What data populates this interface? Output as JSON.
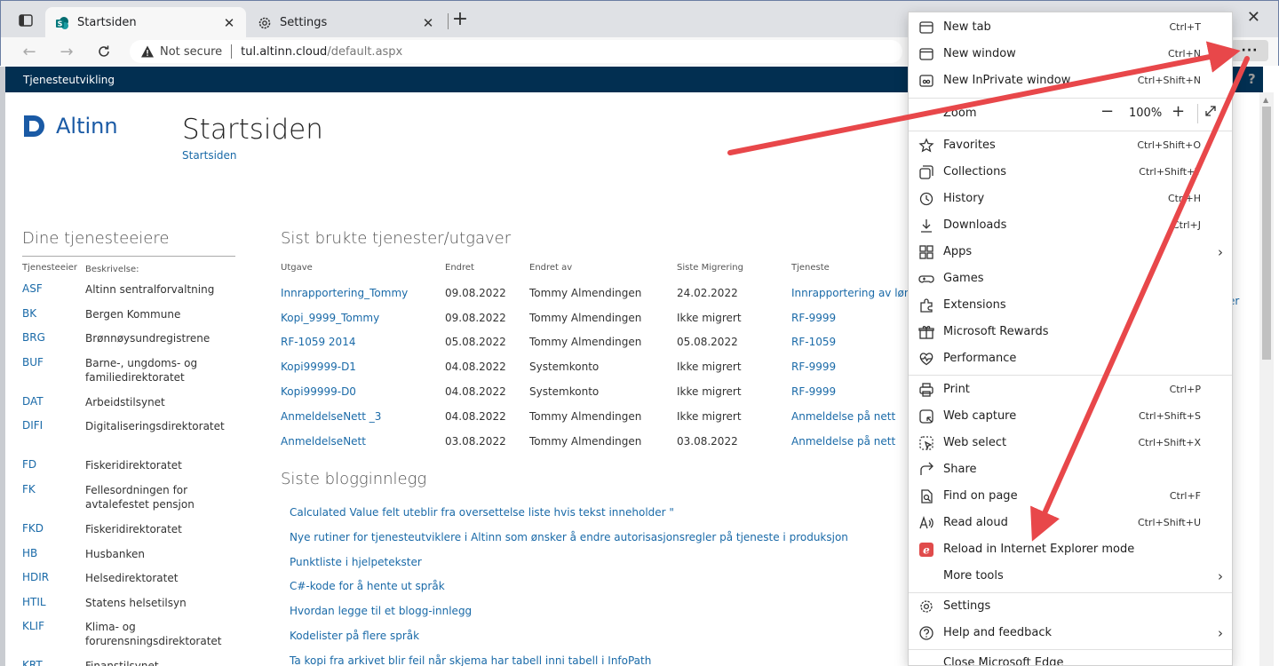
{
  "browser": {
    "tabs": [
      {
        "title": "Startsiden",
        "active": true
      },
      {
        "title": "Settings",
        "active": false
      }
    ],
    "address": {
      "security": "Not secure",
      "host": "tul.altinn.cloud",
      "path": "/default.aspx"
    }
  },
  "site": {
    "topbar": "Tjenesteutvikling",
    "help": "?",
    "logo_text": "Altinn",
    "page_title": "Startsiden",
    "breadcrumb": "Startsiden",
    "edge_fragment": "er"
  },
  "owners": {
    "title": "Dine tjenesteeiere",
    "headers": [
      "Tjenesteeier",
      "Beskrivelse:"
    ],
    "rows": [
      {
        "code": "ASF",
        "desc": "Altinn sentralforvaltning"
      },
      {
        "code": "BK",
        "desc": "Bergen Kommune"
      },
      {
        "code": "BRG",
        "desc": "Brønnøysundregistrene"
      },
      {
        "code": "BUF",
        "desc": "Barne-, ungdoms- og familiedirektoratet"
      },
      {
        "code": "DAT",
        "desc": "Arbeidstilsynet"
      },
      {
        "code": "DIFI",
        "desc": "Digitaliseringsdirektoratet"
      },
      {
        "code": "FD",
        "desc": "Fiskeridirektoratet"
      },
      {
        "code": "FK",
        "desc": "Fellesordningen for avtalefestet pensjon"
      },
      {
        "code": "FKD",
        "desc": "Fiskeridirektoratet"
      },
      {
        "code": "HB",
        "desc": "Husbanken"
      },
      {
        "code": "HDIR",
        "desc": "Helsedirektoratet"
      },
      {
        "code": "HTIL",
        "desc": "Statens helsetilsyn"
      },
      {
        "code": "KLIF",
        "desc": "Klima- og forurensningsdirektoratet"
      },
      {
        "code": "KRT",
        "desc": "Finanstilsynet"
      }
    ]
  },
  "recent": {
    "title": "Sist brukte tjenester/utgaver",
    "headers": [
      "Utgave",
      "Endret",
      "Endret av",
      "Siste Migrering",
      "Tjeneste"
    ],
    "rows": [
      [
        "Innrapportering_Tommy",
        "09.08.2022",
        "Tommy Almendingen",
        "24.02.2022",
        "Innrapportering av lønn"
      ],
      [
        "Kopi_9999_Tommy",
        "09.08.2022",
        "Tommy Almendingen",
        "Ikke migrert",
        "RF-9999"
      ],
      [
        "RF-1059 2014",
        "05.08.2022",
        "Tommy Almendingen",
        "05.08.2022",
        "RF-1059"
      ],
      [
        "Kopi99999-D1",
        "04.08.2022",
        "Systemkonto",
        "Ikke migrert",
        "RF-9999"
      ],
      [
        "Kopi99999-D0",
        "04.08.2022",
        "Systemkonto",
        "Ikke migrert",
        "RF-9999"
      ],
      [
        "AnmeldelseNett _3",
        "04.08.2022",
        "Tommy Almendingen",
        "Ikke migrert",
        "Anmeldelse på nett"
      ],
      [
        "AnmeldelseNett",
        "03.08.2022",
        "Tommy Almendingen",
        "03.08.2022",
        "Anmeldelse på nett"
      ]
    ]
  },
  "blog": {
    "title": "Siste blogginnlegg",
    "items": [
      "Calculated Value felt uteblir fra oversettelse liste hvis tekst inneholder \"",
      "Nye rutiner for tjenesteutviklere i Altinn som ønsker å endre autorisasjonsregler på tjeneste i produksjon",
      "Punktliste i hjelpetekster",
      "C#-kode for å hente ut språk",
      "Hvordan legge til et blogg-innlegg",
      "Kodelister på flere språk",
      "Ta kopi fra arkivet blir feil når skjema har tabell inni tabell i InfoPath"
    ]
  },
  "menu": {
    "items": [
      {
        "label": "New tab",
        "shortcut": "Ctrl+T",
        "icon": "new-tab-icon"
      },
      {
        "label": "New window",
        "shortcut": "Ctrl+N",
        "icon": "new-window-icon"
      },
      {
        "label": "New InPrivate window",
        "shortcut": "Ctrl+Shift+N",
        "icon": "inprivate-icon"
      },
      {
        "label": "Zoom",
        "value": "100%"
      },
      {
        "label": "Favorites",
        "shortcut": "Ctrl+Shift+O",
        "icon": "favorites-icon"
      },
      {
        "label": "Collections",
        "shortcut": "Ctrl+Shift+Y",
        "icon": "collections-icon"
      },
      {
        "label": "History",
        "shortcut": "Ctrl+H",
        "icon": "history-icon"
      },
      {
        "label": "Downloads",
        "shortcut": "Ctrl+J",
        "icon": "downloads-icon"
      },
      {
        "label": "Apps",
        "icon": "apps-icon"
      },
      {
        "label": "Games",
        "icon": "games-icon"
      },
      {
        "label": "Extensions",
        "icon": "extensions-icon"
      },
      {
        "label": "Microsoft Rewards",
        "icon": "rewards-icon"
      },
      {
        "label": "Performance",
        "icon": "performance-icon"
      },
      {
        "label": "Print",
        "shortcut": "Ctrl+P",
        "icon": "print-icon"
      },
      {
        "label": "Web capture",
        "shortcut": "Ctrl+Shift+S",
        "icon": "web-capture-icon"
      },
      {
        "label": "Web select",
        "shortcut": "Ctrl+Shift+X",
        "icon": "web-select-icon"
      },
      {
        "label": "Share",
        "icon": "share-icon"
      },
      {
        "label": "Find on page",
        "shortcut": "Ctrl+F",
        "icon": "find-icon"
      },
      {
        "label": "Read aloud",
        "shortcut": "Ctrl+Shift+U",
        "icon": "read-aloud-icon"
      },
      {
        "label": "Reload in Internet Explorer mode",
        "icon": "ie-mode-icon"
      },
      {
        "label": "More tools"
      },
      {
        "label": "Settings",
        "icon": "settings-icon"
      },
      {
        "label": "Help and feedback",
        "icon": "help-icon"
      },
      {
        "label": "Close Microsoft Edge"
      }
    ]
  },
  "colors": {
    "accent": "#1a6aa8",
    "header": "#022f51",
    "annotation": "#e8474a"
  }
}
